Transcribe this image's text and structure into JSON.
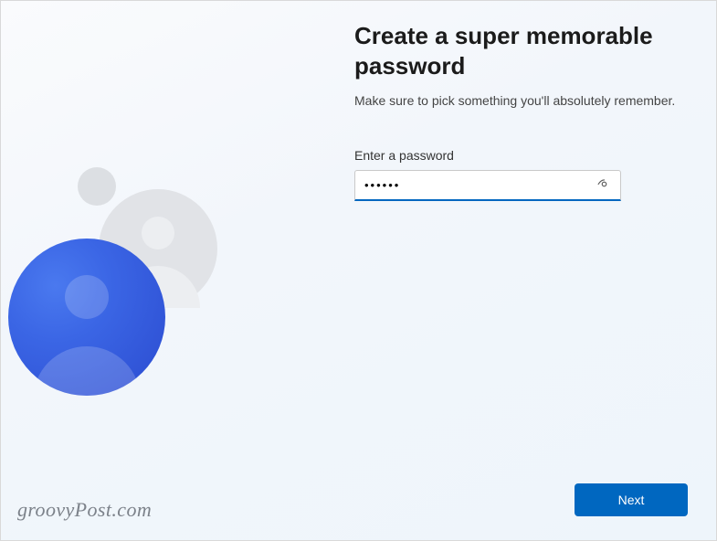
{
  "header": {
    "title": "Create a super memorable password",
    "subtitle": "Make sure to pick something you'll absolutely remember."
  },
  "form": {
    "password_label": "Enter a password",
    "password_value": "••••••",
    "password_placeholder": ""
  },
  "actions": {
    "next_label": "Next"
  },
  "watermark": "groovyPost.com"
}
